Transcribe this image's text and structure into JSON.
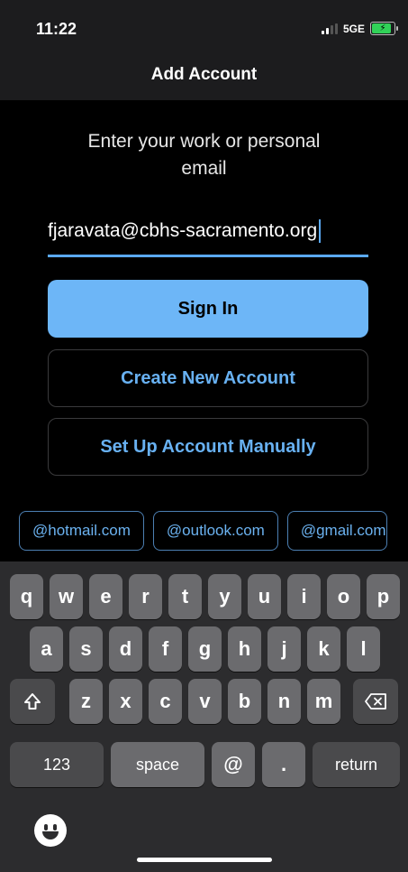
{
  "status": {
    "time": "11:22",
    "network": "5GE"
  },
  "nav": {
    "title": "Add Account"
  },
  "prompt": {
    "text": "Enter your work or personal email"
  },
  "email": {
    "value": "fjaravata@cbhs-sacramento.org"
  },
  "buttons": {
    "sign_in": "Sign In",
    "create_account": "Create New Account",
    "manual_setup": "Set Up Account Manually"
  },
  "suggestions": [
    "@hotmail.com",
    "@outlook.com",
    "@gmail.com"
  ],
  "keyboard": {
    "row1": [
      "q",
      "w",
      "e",
      "r",
      "t",
      "y",
      "u",
      "i",
      "o",
      "p"
    ],
    "row2": [
      "a",
      "s",
      "d",
      "f",
      "g",
      "h",
      "j",
      "k",
      "l"
    ],
    "row3": [
      "z",
      "x",
      "c",
      "v",
      "b",
      "n",
      "m"
    ],
    "numbers": "123",
    "space": "space",
    "at": "@",
    "dot": ".",
    "return": "return"
  },
  "colors": {
    "accent": "#6db6f7",
    "link": "#68b1f2",
    "background": "#000000"
  }
}
